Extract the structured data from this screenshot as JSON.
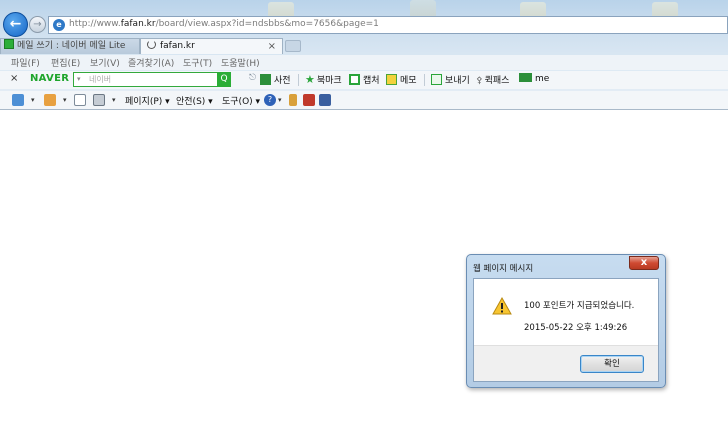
{
  "browser": {
    "url_prefix": "http://www.",
    "url_host": "fafan.kr",
    "url_path": "/board/view.aspx?id=ndsbbs&mo=7656&page=1",
    "tabs": [
      {
        "label": "메일 쓰기 : 네이버 메일 Lite",
        "active": false
      },
      {
        "label": "fafan.kr",
        "active": true
      }
    ],
    "tab_close": "×"
  },
  "menu": {
    "items": [
      "파일(F)",
      "편집(E)",
      "보기(V)",
      "즐겨찾기(A)",
      "도구(T)",
      "도움말(H)"
    ]
  },
  "naver_toolbar": {
    "close": "×",
    "logo": "NAVER",
    "search_dropdown": "▾",
    "search_placeholder": "네이버",
    "search_go": "Q",
    "dictionary": "사전",
    "bookmark": "북마크",
    "capture": "캡처",
    "memo": "메모",
    "send": "보내기",
    "quick_pass": "퀵패스",
    "me": "me"
  },
  "command_bar": {
    "page": "페이지(P)",
    "safety": "안전(S)",
    "tools": "도구(O)",
    "dropdown": "▾"
  },
  "dialog": {
    "title": "웹 페이지 메시지",
    "close": "x",
    "message": "100 포인트가 지급되었습니다.",
    "timestamp": "2015-05-22 오후 1:49:26",
    "ok_label": "확인"
  },
  "colors": {
    "naver_green": "#1ea52b",
    "ie_blue": "#1565c6",
    "close_red": "#cf4a32",
    "focus_blue": "#3a86c8"
  }
}
